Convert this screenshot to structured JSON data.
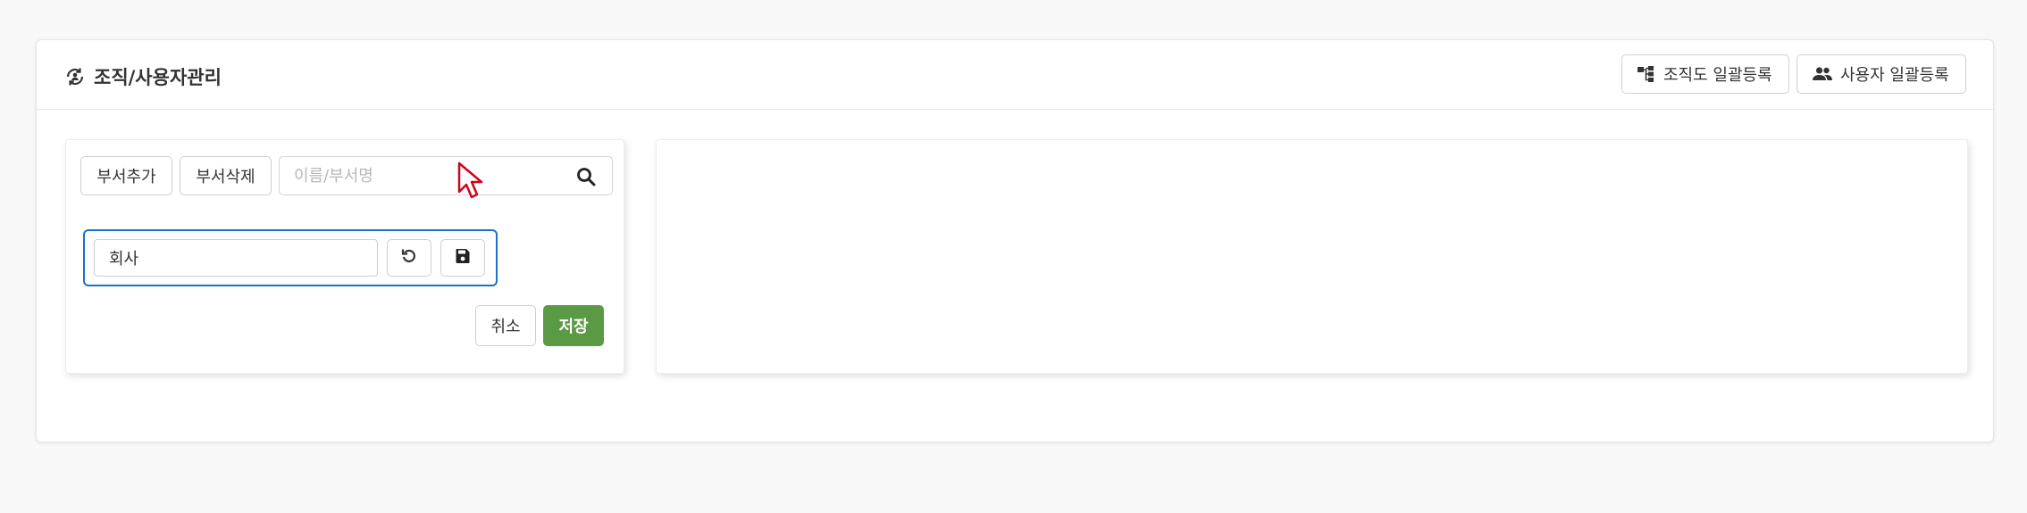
{
  "header": {
    "title": "조직/사용자관리",
    "title_icon": "org-refresh-icon",
    "org_bulk_label": "조직도 일괄등록",
    "user_bulk_label": "사용자 일괄등록"
  },
  "left_panel": {
    "add_dept_label": "부서추가",
    "delete_dept_label": "부서삭제",
    "search": {
      "placeholder": "이름/부서명",
      "value": ""
    },
    "node_edit": {
      "value": "회사"
    },
    "cancel_label": "취소",
    "save_label": "저장"
  },
  "colors": {
    "accent_blue": "#1a73c8",
    "save_green": "#5b9a45",
    "cursor_red": "#d0021b"
  }
}
